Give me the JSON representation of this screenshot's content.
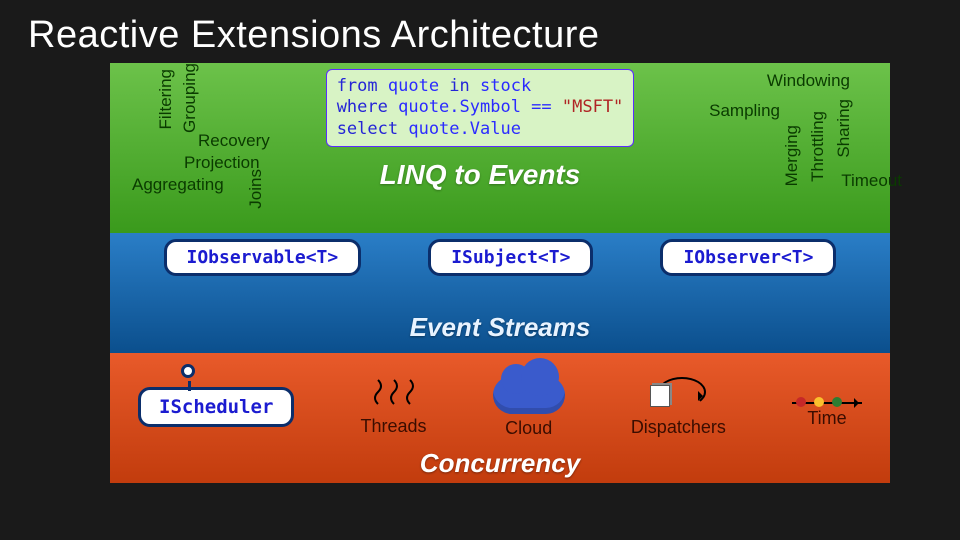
{
  "title": "Reactive Extensions Architecture",
  "green": {
    "ops_left": {
      "filtering": "Filtering",
      "grouping": "Grouping",
      "recovery": "Recovery",
      "projection": "Projection",
      "aggregating": "Aggregating",
      "joins": "Joins"
    },
    "code": {
      "l1a": "from",
      "l1b": " quote ",
      "l1c": "in",
      "l1d": " stock",
      "l2a": "where",
      "l2b": " quote.Symbol == ",
      "l2c": "\"MSFT\"",
      "l3a": "select",
      "l3b": " quote.Value"
    },
    "headline": "LINQ to Events",
    "ops_right": {
      "windowing": "Windowing",
      "sampling": "Sampling",
      "sharing": "Sharing",
      "throttling": "Throttling",
      "merging": "Merging",
      "timeout": "Timeout"
    }
  },
  "blue": {
    "iface1": "IObservable<T>",
    "iface2": "ISubject<T>",
    "iface3": "IObserver<T>",
    "headline": "Event Streams"
  },
  "red": {
    "iface": "IScheduler",
    "items": {
      "threads": "Threads",
      "cloud": "Cloud",
      "dispatchers": "Dispatchers",
      "time": "Time"
    },
    "headline": "Concurrency"
  }
}
